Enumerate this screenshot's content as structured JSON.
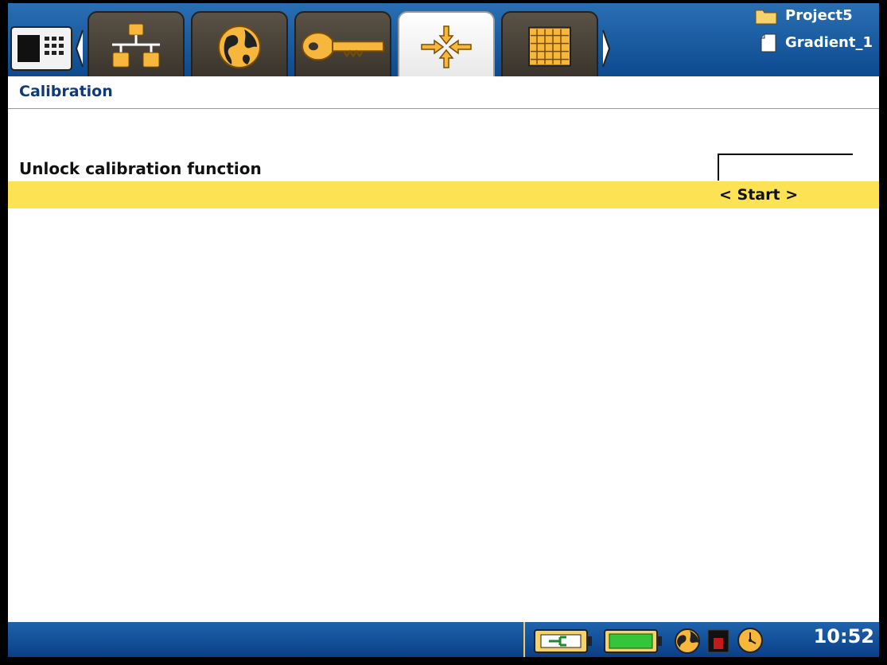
{
  "header": {
    "project_name": "Project5",
    "file_name": "Gradient_1",
    "tabs": [
      {
        "icon": "network-icon",
        "active": false
      },
      {
        "icon": "globe-icon",
        "active": false
      },
      {
        "icon": "key-icon",
        "active": false
      },
      {
        "icon": "calibration-arrows-icon",
        "active": true
      },
      {
        "icon": "grid-table-icon",
        "active": false
      }
    ]
  },
  "page": {
    "title": "Calibration",
    "unlock_label": "Unlock calibration function",
    "unlock_value": "",
    "start_label": "< Start >"
  },
  "status": {
    "time": "10:52"
  },
  "colors": {
    "accent_blue": "#0d4a8f",
    "highlight_yellow": "#fde254",
    "title_text": "#0f3a78"
  }
}
